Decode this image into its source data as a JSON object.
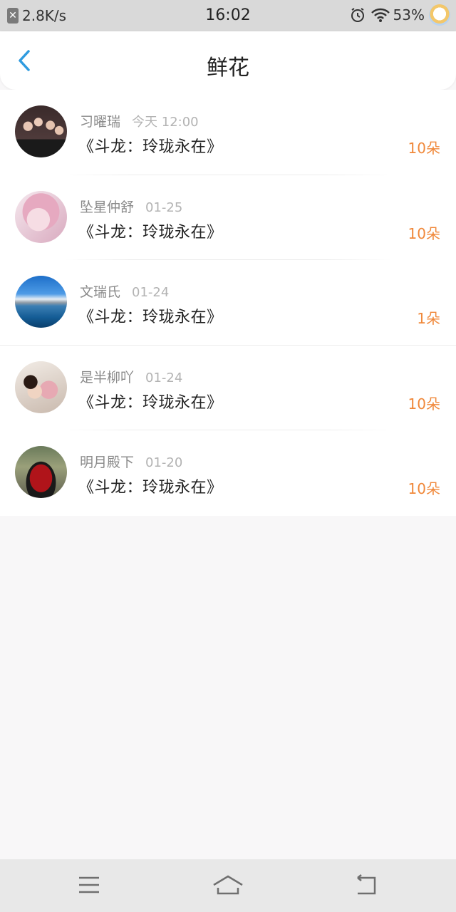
{
  "status_bar": {
    "net_speed": "2.8K/s",
    "time": "16:02",
    "battery": "53%"
  },
  "header": {
    "title": "鲜花"
  },
  "items": [
    {
      "name": "习曜瑞",
      "date": "今天 12:00",
      "book": "《斗龙：玲珑永在》",
      "count": "10朵"
    },
    {
      "name": "坠星仲舒",
      "date": "01-25",
      "book": "《斗龙：玲珑永在》",
      "count": "10朵"
    },
    {
      "name": "文瑞氏",
      "date": "01-24",
      "book": "《斗龙：玲珑永在》",
      "count": "1朵"
    },
    {
      "name": "是半柳吖",
      "date": "01-24",
      "book": "《斗龙：玲珑永在》",
      "count": "10朵"
    },
    {
      "name": "明月殿下",
      "date": "01-20",
      "book": "《斗龙：玲珑永在》",
      "count": "10朵"
    }
  ],
  "colors": {
    "accent_blue": "#2f9bdf",
    "count_orange": "#f0883a"
  }
}
